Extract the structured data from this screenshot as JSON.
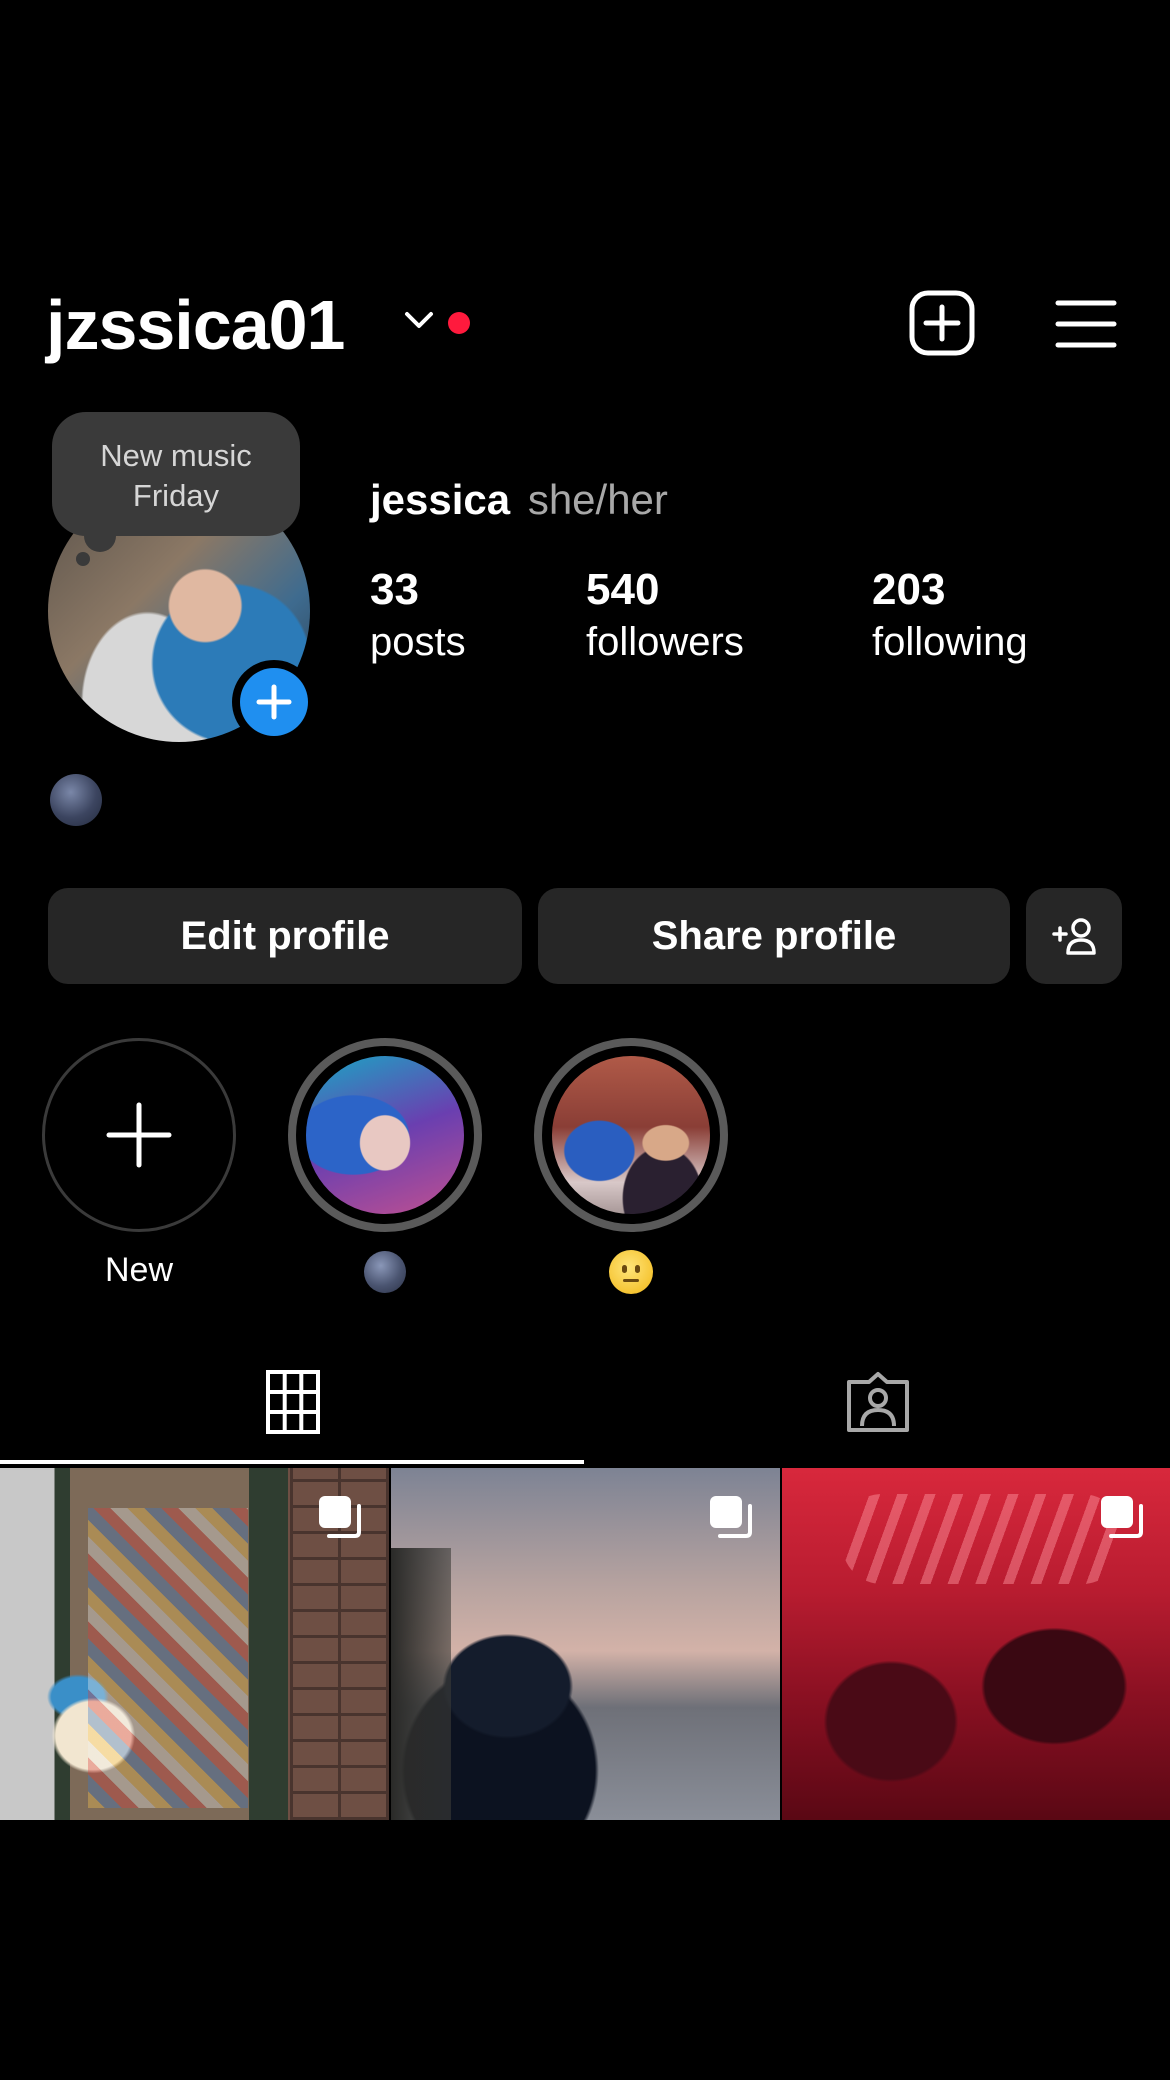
{
  "header": {
    "username": "jzssica01",
    "notification_color": "#ff1a3d"
  },
  "profile": {
    "note": [
      "New music",
      "Friday"
    ],
    "display_name": "jessica",
    "pronouns": "she/her",
    "stats": [
      {
        "value": "33",
        "label": "posts"
      },
      {
        "value": "540",
        "label": "followers"
      },
      {
        "value": "203",
        "label": "following"
      }
    ],
    "bio_emoji": "new-moon-emoji"
  },
  "buttons": {
    "edit": "Edit profile",
    "share": "Share profile"
  },
  "highlights": [
    {
      "label": "New",
      "icon": "plus-icon"
    },
    {
      "label": "",
      "icon": "new-moon-emoji"
    },
    {
      "label": "",
      "icon": "neutral-face-emoji"
    }
  ],
  "tabs": [
    {
      "icon": "grid-icon",
      "active": true
    },
    {
      "icon": "tagged-icon",
      "active": false
    }
  ],
  "posts": [
    {
      "description": "photo",
      "multi": true
    },
    {
      "description": "photo",
      "multi": true
    },
    {
      "description": "photo",
      "multi": true
    }
  ],
  "colors": {
    "background": "#000000",
    "button_bg": "#262626",
    "accent_blue": "#1f8ff0"
  }
}
